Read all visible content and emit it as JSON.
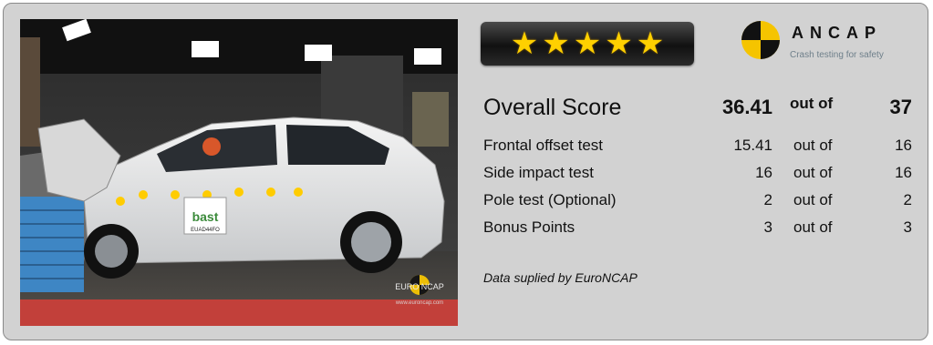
{
  "photo": {
    "sticker": "bast",
    "plate": "EUAD44FO",
    "watermark": "EURO NCAP",
    "watermark_url": "www.euroncap.com"
  },
  "rating": {
    "stars": 5
  },
  "logo": {
    "name": "ANCAP",
    "tagline": "Crash testing for safety"
  },
  "overall": {
    "label": "Overall Score",
    "score": "36.41",
    "out_of": "out of",
    "max": "37"
  },
  "tests": [
    {
      "label": "Frontal offset test",
      "score": "15.41",
      "out_of": "out of",
      "max": "16"
    },
    {
      "label": "Side impact test",
      "score": "16",
      "out_of": "out of",
      "max": "16"
    },
    {
      "label": "Pole test (Optional)",
      "score": "2",
      "out_of": "out of",
      "max": "2"
    },
    {
      "label": "Bonus Points",
      "score": "3",
      "out_of": "out of",
      "max": "3"
    }
  ],
  "footer": {
    "note": "Data suplied by EuroNCAP"
  },
  "colors": {
    "panel": "#d2d2d2",
    "star": "#ffd000",
    "logo_yellow": "#f5c400"
  }
}
